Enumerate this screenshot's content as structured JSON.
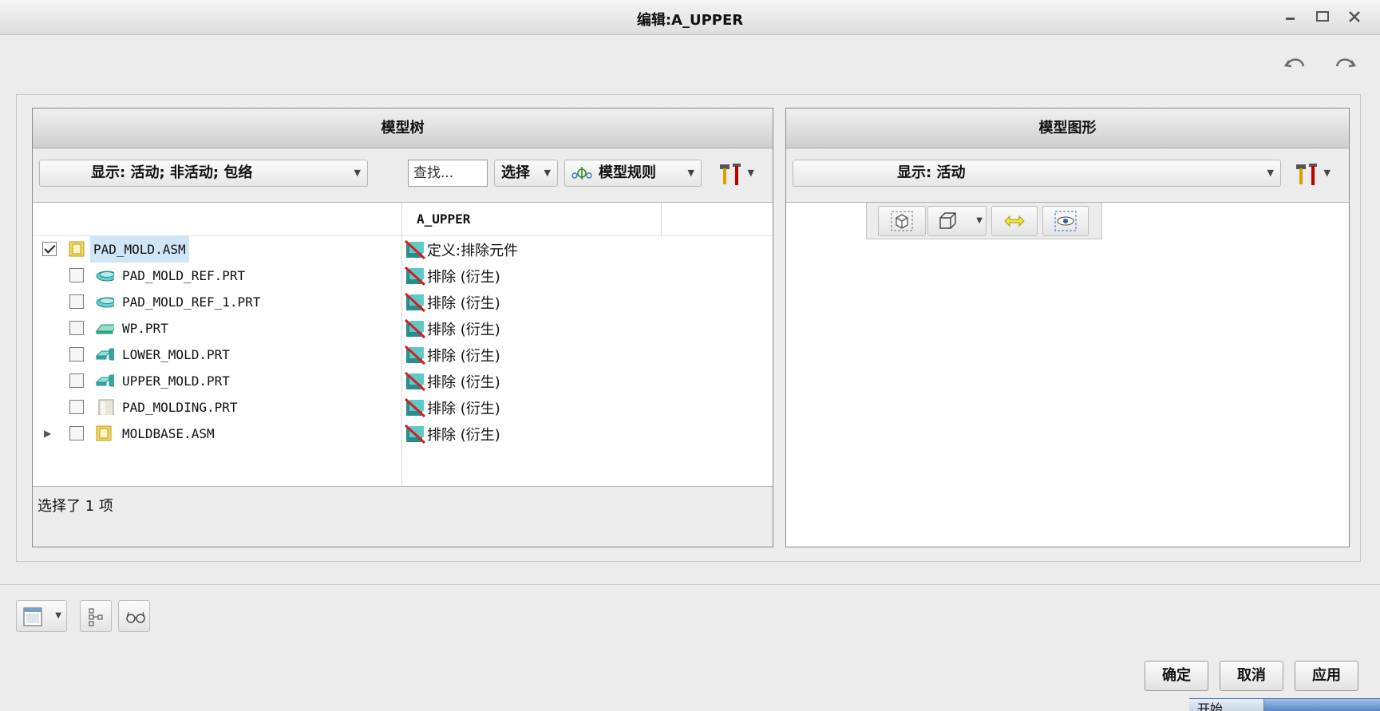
{
  "window": {
    "title": "编辑:A_UPPER"
  },
  "left_panel": {
    "header": "模型树",
    "display_dropdown": "显示: 活动; 非活动; 包络",
    "find_placeholder": "查找...",
    "select_dropdown": "选择",
    "model_rules": "模型规则",
    "column_header": "A_UPPER",
    "rows": [
      {
        "name": "PAD_MOLD.ASM",
        "icon": "assembly-icon",
        "checked": true,
        "status": "定义:排除元件"
      },
      {
        "name": "PAD_MOLD_REF.PRT",
        "icon": "reference-part-icon",
        "checked": false,
        "status": "排除 (衍生)"
      },
      {
        "name": "PAD_MOLD_REF_1.PRT",
        "icon": "reference-part-icon",
        "checked": false,
        "status": "排除 (衍生)"
      },
      {
        "name": "WP.PRT",
        "icon": "workpiece-icon",
        "checked": false,
        "status": "排除 (衍生)"
      },
      {
        "name": "LOWER_MOLD.PRT",
        "icon": "mold-volume-icon",
        "checked": false,
        "status": "排除 (衍生)"
      },
      {
        "name": "UPPER_MOLD.PRT",
        "icon": "mold-volume-icon",
        "checked": false,
        "status": "排除 (衍生)"
      },
      {
        "name": "PAD_MOLDING.PRT",
        "icon": "molding-part-icon",
        "checked": false,
        "status": "排除 (衍生)"
      },
      {
        "name": "MOLDBASE.ASM",
        "icon": "assembly-icon",
        "checked": false,
        "status": "排除 (衍生)"
      }
    ],
    "status_text": "选择了 1 项"
  },
  "right_panel": {
    "header": "模型图形",
    "display_dropdown": "显示: 活动"
  },
  "buttons": {
    "ok": "确定",
    "cancel": "取消",
    "apply": "应用"
  },
  "taskbar": {
    "start_label": "开始"
  },
  "colors": {
    "selection": "#cfe6f7",
    "header_top": "#f0f0f0",
    "header_bottom": "#cfcfcf",
    "exclude_red": "#d22020",
    "icon_teal": "#3aa3a3"
  }
}
